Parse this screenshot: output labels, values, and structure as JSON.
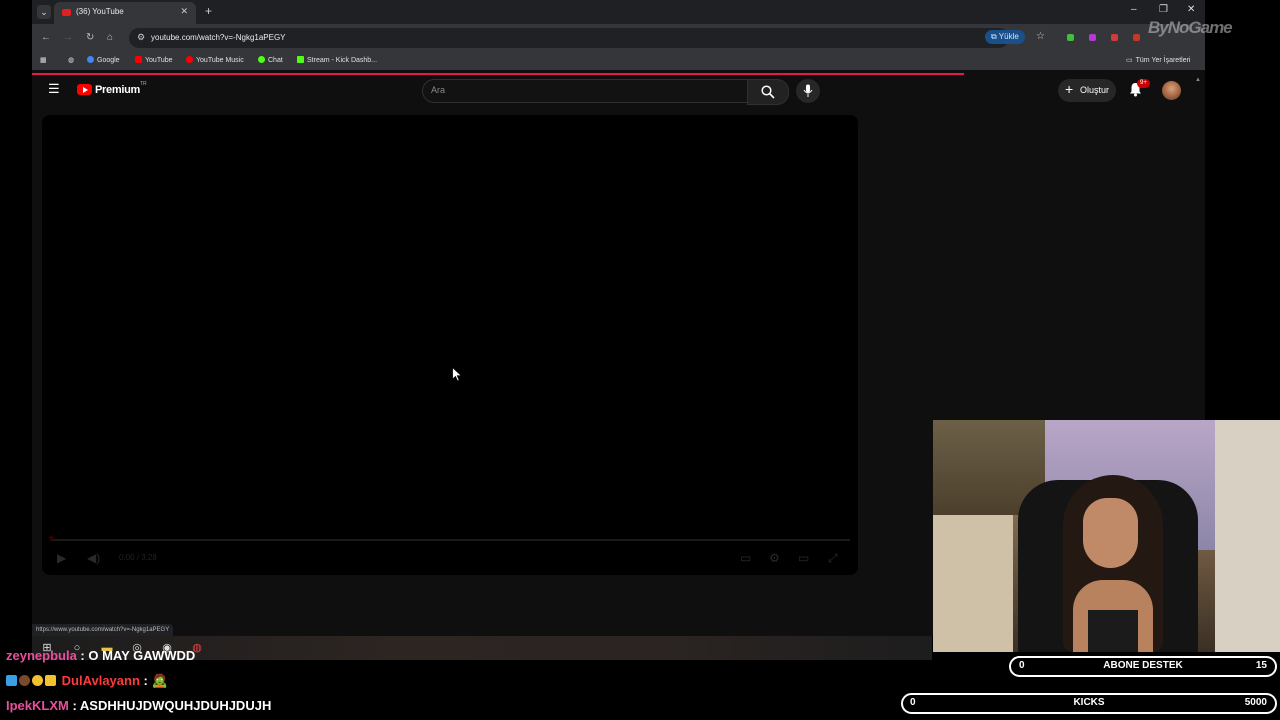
{
  "browser": {
    "tab_title": "(36) YouTube",
    "url": "youtube.com/watch?v=-Ngkg1aPEGY",
    "install_label": "Yükle",
    "status_url": "https://www.youtube.com/watch?v=-Ngkg1aPEGY",
    "bookmarks": [
      "Google",
      "YouTube",
      "YouTube Music",
      "Chat",
      "Stream - Kick Dashb..."
    ],
    "all_bookmarks_label": "Tüm Yer İşaretleri"
  },
  "youtube": {
    "logo_text": "Premium",
    "region": "TR",
    "search_placeholder": "Ara",
    "create_label": "Oluştur",
    "notification_count": "9+",
    "player_time": "0:00 / 3:28"
  },
  "overlay": {
    "watermark": "ByNoGame",
    "chat": [
      {
        "user": "zeynepbula",
        "message": "O MAY GAWWDD",
        "color": "#e94f9c"
      },
      {
        "user": "DulAvlayann",
        "message": "🧟",
        "color": "#ff3b3b"
      },
      {
        "user": "IpekKLXM",
        "message": "ASDHHUJDWQUHJDUHJDUJH",
        "color": "#e94f9c"
      }
    ],
    "goals": [
      {
        "label": "ABONE DESTEK",
        "current": "0",
        "target": "15"
      },
      {
        "label": "KICKS",
        "current": "0",
        "target": "5000"
      }
    ]
  }
}
